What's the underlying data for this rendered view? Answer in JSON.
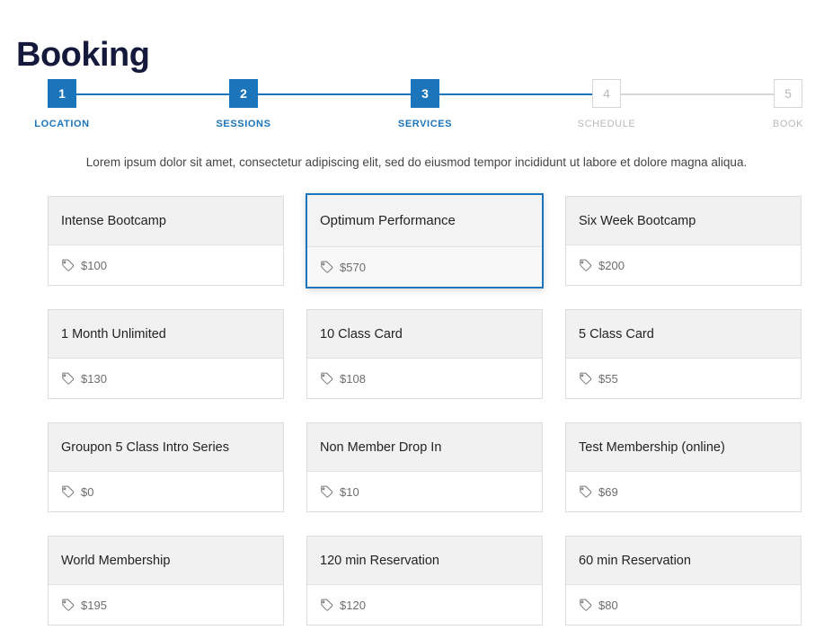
{
  "page": {
    "title": "Booking",
    "intro": "Lorem ipsum dolor sit amet, consectetur adipiscing elit, sed do eiusmod tempor incididunt ut labore et dolore magna aliqua."
  },
  "colors": {
    "accent": "#1b75bb",
    "title": "#151a3d",
    "inactive": "#b9b9b9",
    "card_header": "#f1f1f1",
    "card_border": "#dcdcdc",
    "price_text": "#6d6d6d"
  },
  "stepper": {
    "current_step": 3,
    "steps": [
      {
        "number": "1",
        "label": "LOCATION",
        "state": "active"
      },
      {
        "number": "2",
        "label": "SESSIONS",
        "state": "active"
      },
      {
        "number": "3",
        "label": "SERVICES",
        "state": "active"
      },
      {
        "number": "4",
        "label": "SCHEDULE",
        "state": "inactive"
      },
      {
        "number": "5",
        "label": "BOOK",
        "state": "inactive"
      }
    ]
  },
  "services": {
    "price_icon": "tag-icon",
    "selected_index": 1,
    "items": [
      {
        "name": "Intense Bootcamp",
        "price": "$100",
        "selected": false
      },
      {
        "name": "Optimum Performance",
        "price": "$570",
        "selected": true
      },
      {
        "name": "Six Week Bootcamp",
        "price": "$200",
        "selected": false
      },
      {
        "name": "1 Month Unlimited",
        "price": "$130",
        "selected": false
      },
      {
        "name": "10 Class Card",
        "price": "$108",
        "selected": false
      },
      {
        "name": "5 Class Card",
        "price": "$55",
        "selected": false
      },
      {
        "name": "Groupon 5 Class Intro Series",
        "price": "$0",
        "selected": false
      },
      {
        "name": "Non Member Drop In",
        "price": "$10",
        "selected": false
      },
      {
        "name": "Test Membership (online)",
        "price": "$69",
        "selected": false
      },
      {
        "name": "World Membership",
        "price": "$195",
        "selected": false
      },
      {
        "name": "120 min Reservation",
        "price": "$120",
        "selected": false
      },
      {
        "name": "60 min Reservation",
        "price": "$80",
        "selected": false
      }
    ]
  }
}
